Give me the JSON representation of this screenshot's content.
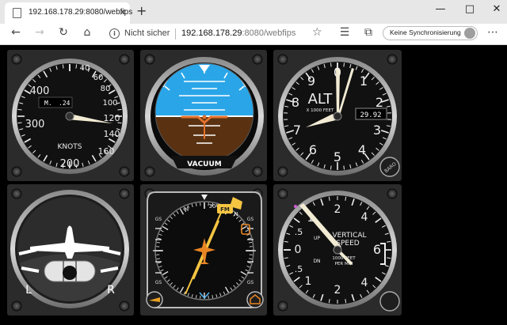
{
  "browser": {
    "tab_title": "192.168.178.29:8080/webfips",
    "tab_close_icon": "×",
    "new_tab_icon": "+",
    "window_controls": {
      "minimize": "—",
      "maximize": "□",
      "close": "✕"
    },
    "address": {
      "security_label": "Nicht sicher",
      "url_host": "192.168.178.29",
      "url_rest": ":8080/webfips"
    },
    "sync_label": "Keine Synchronisierung"
  },
  "instruments": {
    "airspeed": {
      "numbers": [
        "40",
        "60",
        "80",
        "100",
        "120",
        "140",
        "160",
        "200",
        "300",
        "400"
      ],
      "mach_label": "M.",
      "mach_value": ".24",
      "units": "KNOTS"
    },
    "attitude": {
      "label": "VACUUM"
    },
    "altimeter": {
      "numbers": [
        "0",
        "1",
        "2",
        "3",
        "4",
        "5",
        "6",
        "7",
        "8",
        "9"
      ],
      "title": "ALT",
      "subtitle": "X 1000 FEET",
      "kollsman": "29.92",
      "knob_label": "BARO"
    },
    "turn_coordinator": {
      "left": "L",
      "right": "R"
    },
    "hsi": {
      "gs_left": [
        "GS",
        "GS"
      ],
      "gs_right": [
        "GS",
        "GS"
      ],
      "card_labels": [
        "30",
        "W",
        "N"
      ],
      "fm_label": "FM"
    },
    "vsi": {
      "numbers": [
        "2",
        "4",
        "1",
        ".5",
        "0",
        "6",
        ".5",
        "1",
        "2",
        "4"
      ],
      "up": "UP",
      "dn": "DN",
      "title_line1": "VERTICAL",
      "title_line2": "SPEED",
      "units_line1": "1000 FEET",
      "units_line2": "PER MIN"
    }
  }
}
